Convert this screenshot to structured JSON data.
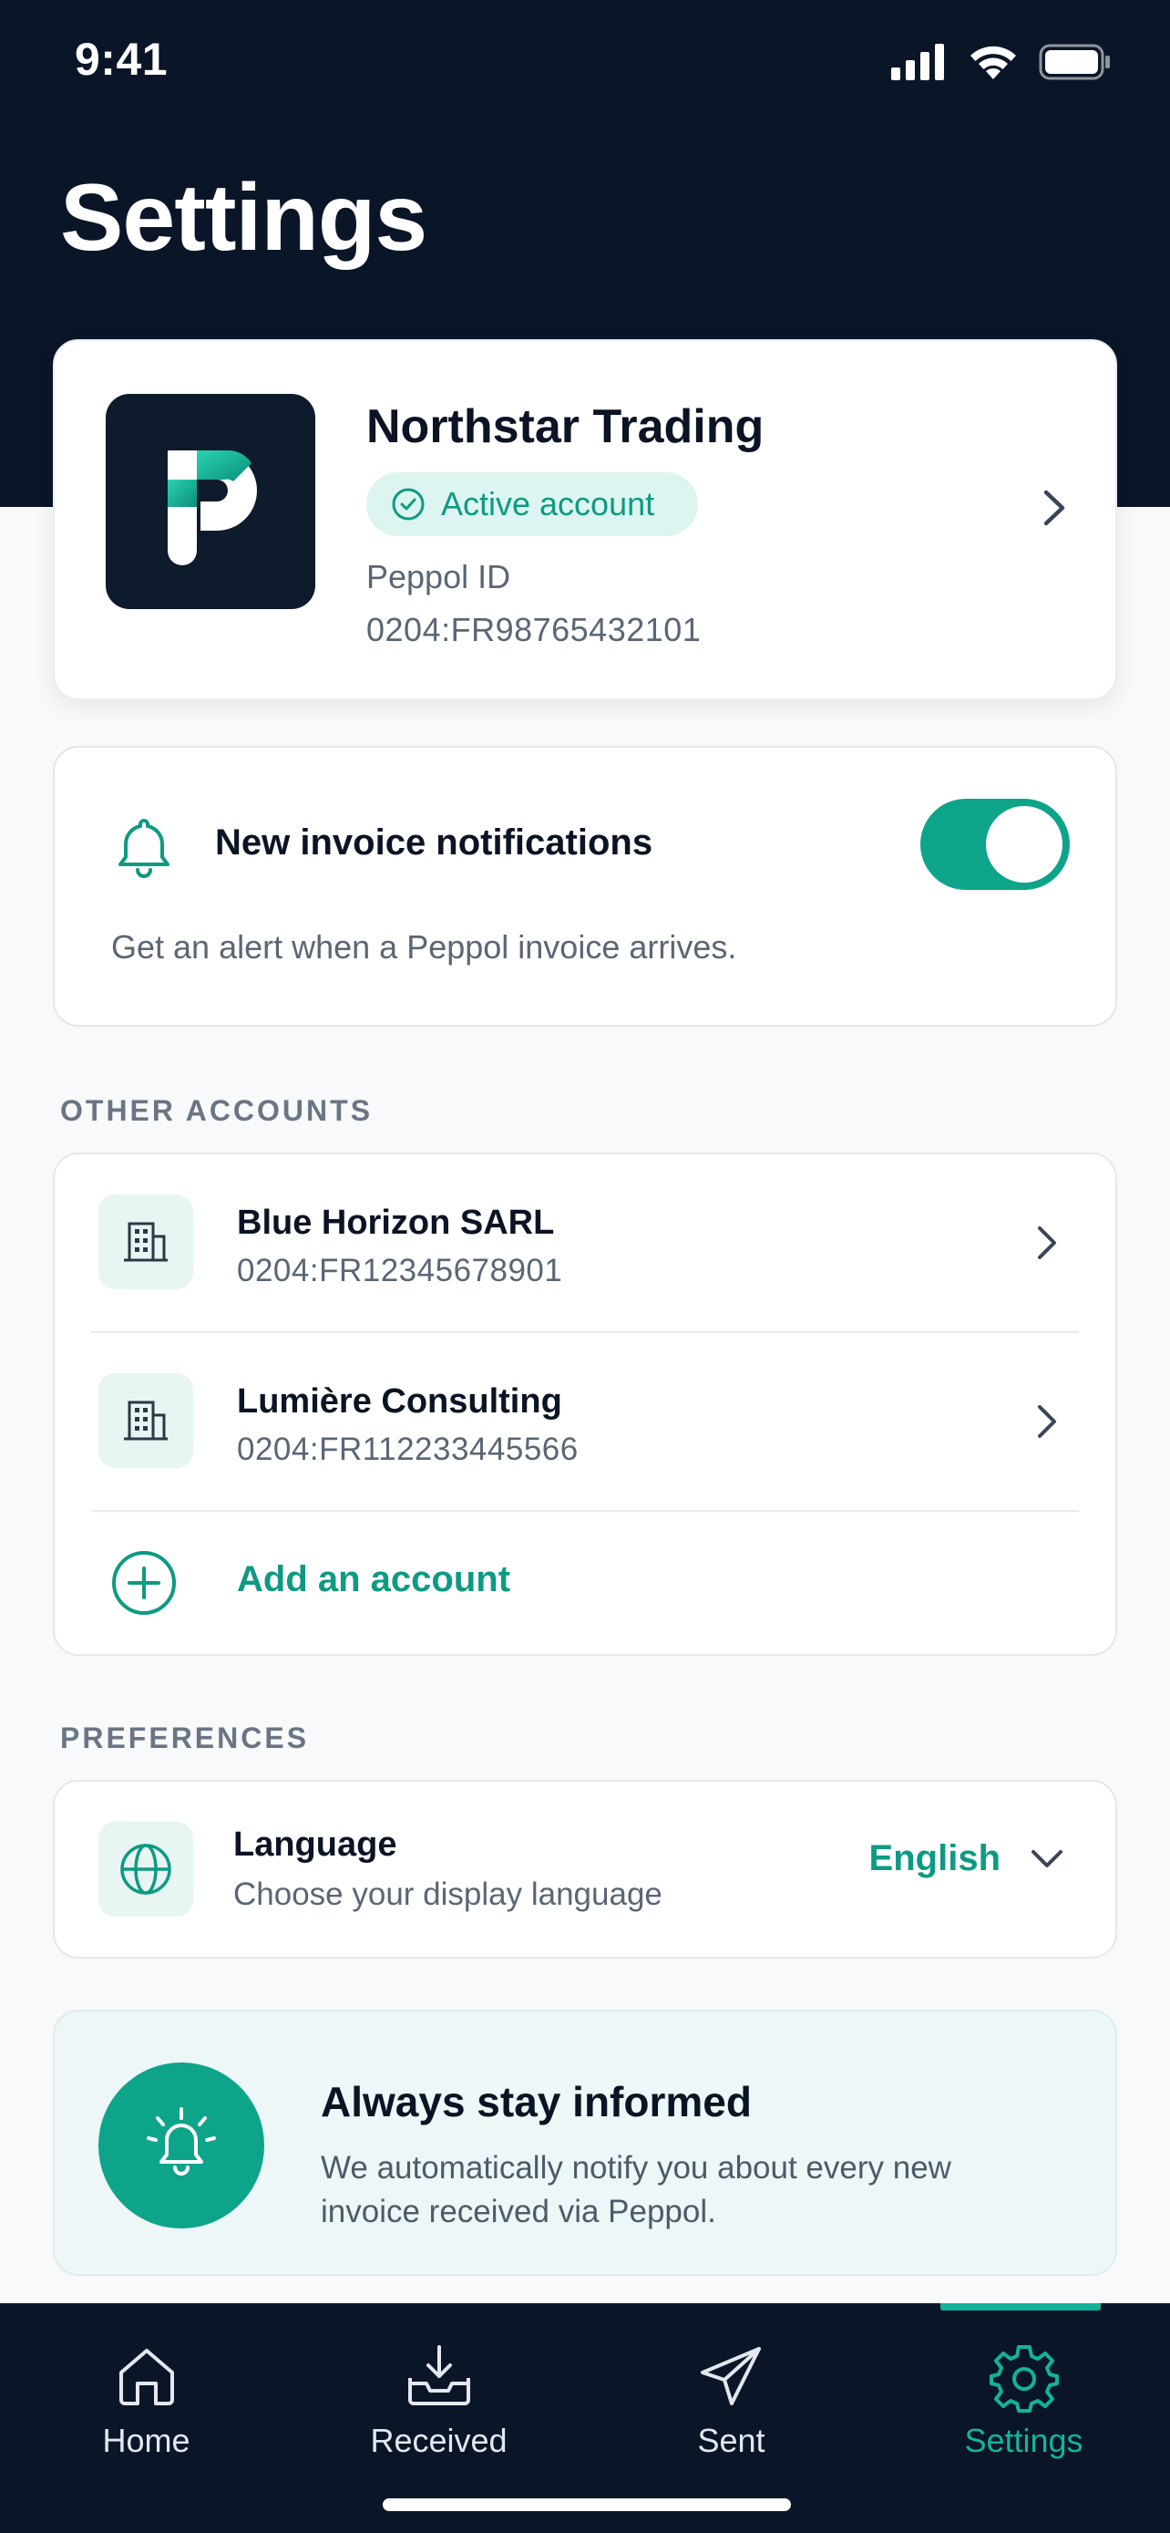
{
  "status_bar": {
    "time": "9:41"
  },
  "page": {
    "title": "Settings"
  },
  "current_account": {
    "name": "Northstar Trading",
    "status": "Active account",
    "peppol_label": "Peppol ID",
    "peppol_id": "0204:FR98765432101"
  },
  "notifications": {
    "title": "New invoice notifications",
    "description": "Get an alert when a Peppol invoice arrives.",
    "enabled": true
  },
  "other_accounts": {
    "section_label": "OTHER ACCOUNTS",
    "items": [
      {
        "name": "Blue Horizon SARL",
        "peppol_id": "0204:FR12345678901"
      },
      {
        "name": "Lumière Consulting",
        "peppol_id": "0204:FR112233445566"
      }
    ],
    "add_label": "Add an account"
  },
  "preferences": {
    "section_label": "PREFERENCES",
    "language": {
      "title": "Language",
      "subtitle": "Choose your display language",
      "value": "English"
    }
  },
  "info": {
    "title": "Always stay informed",
    "description": "We automatically notify you about every new invoice received via Peppol."
  },
  "tabs": [
    {
      "label": "Home",
      "icon": "home-icon"
    },
    {
      "label": "Received",
      "icon": "inbox-download-icon"
    },
    {
      "label": "Sent",
      "icon": "paper-plane-icon"
    },
    {
      "label": "Settings",
      "icon": "gear-icon",
      "active": true
    }
  ],
  "colors": {
    "header": "#0A1628",
    "accent": "#0DA48A",
    "accent_text": "#0E9A82",
    "background": "#F7F9FA"
  }
}
